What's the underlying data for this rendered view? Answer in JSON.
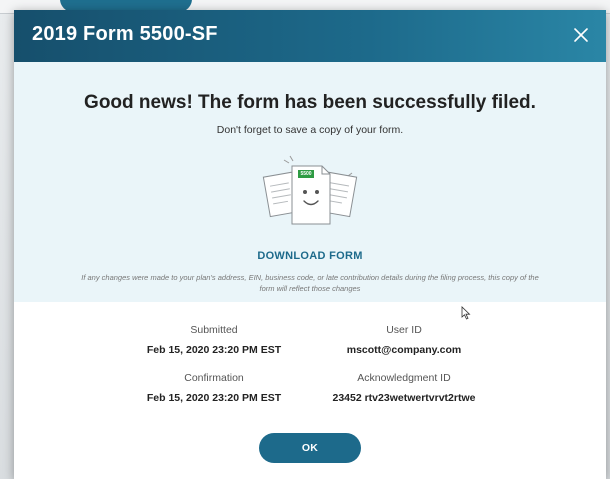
{
  "modal": {
    "title": "2019 Form 5500-SF",
    "close_label": "×"
  },
  "hero": {
    "headline": "Good news! The form has been successfully filed.",
    "subline": "Don't forget to save a copy of your form.",
    "badge_text": "5500",
    "download_label": "DOWNLOAD FORM",
    "disclaimer": "If any changes were made to your plan's address, EIN, business code, or late contribution details during the filing process, this copy of the form will reflect those changes"
  },
  "details": {
    "submitted_label": "Submitted",
    "submitted_value": "Feb 15, 2020 23:20 PM EST",
    "user_id_label": "User ID",
    "user_id_value": "mscott@company.com",
    "confirmation_label": "Confirmation",
    "confirmation_value": "Feb 15, 2020 23:20 PM EST",
    "ack_label": "Acknowledgment ID",
    "ack_value": "23452 rtv23wetwertvrvt2rtwe"
  },
  "actions": {
    "ok_label": "OK"
  },
  "colors": {
    "header": "#1d6a8b",
    "hero_bg": "#eaf5f9",
    "badge": "#2e9b43",
    "accent": "#1d6a8b"
  }
}
